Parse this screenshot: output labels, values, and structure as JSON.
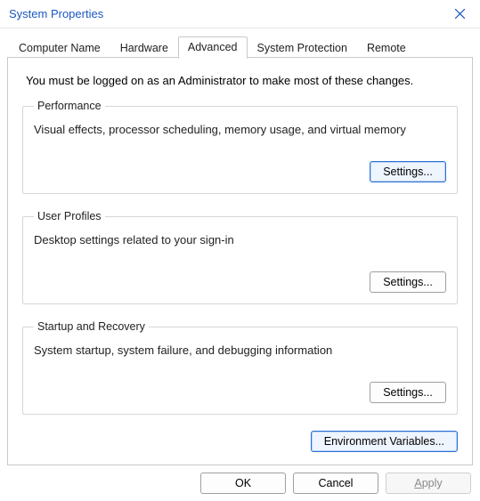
{
  "titlebar": {
    "title": "System Properties"
  },
  "tabs": {
    "computer_name": "Computer Name",
    "hardware": "Hardware",
    "advanced": "Advanced",
    "system_protection": "System Protection",
    "remote": "Remote"
  },
  "intro": "You must be logged on as an Administrator to make most of these changes.",
  "groups": {
    "performance": {
      "legend": "Performance",
      "desc": "Visual effects, processor scheduling, memory usage, and virtual memory",
      "button": "Settings..."
    },
    "user_profiles": {
      "legend": "User Profiles",
      "desc": "Desktop settings related to your sign-in",
      "button": "Settings..."
    },
    "startup": {
      "legend": "Startup and Recovery",
      "desc": "System startup, system failure, and debugging information",
      "button": "Settings..."
    }
  },
  "env_button": "Environment Variables...",
  "footer": {
    "ok": "OK",
    "cancel": "Cancel",
    "apply": "pply",
    "apply_mnemonic": "A"
  }
}
